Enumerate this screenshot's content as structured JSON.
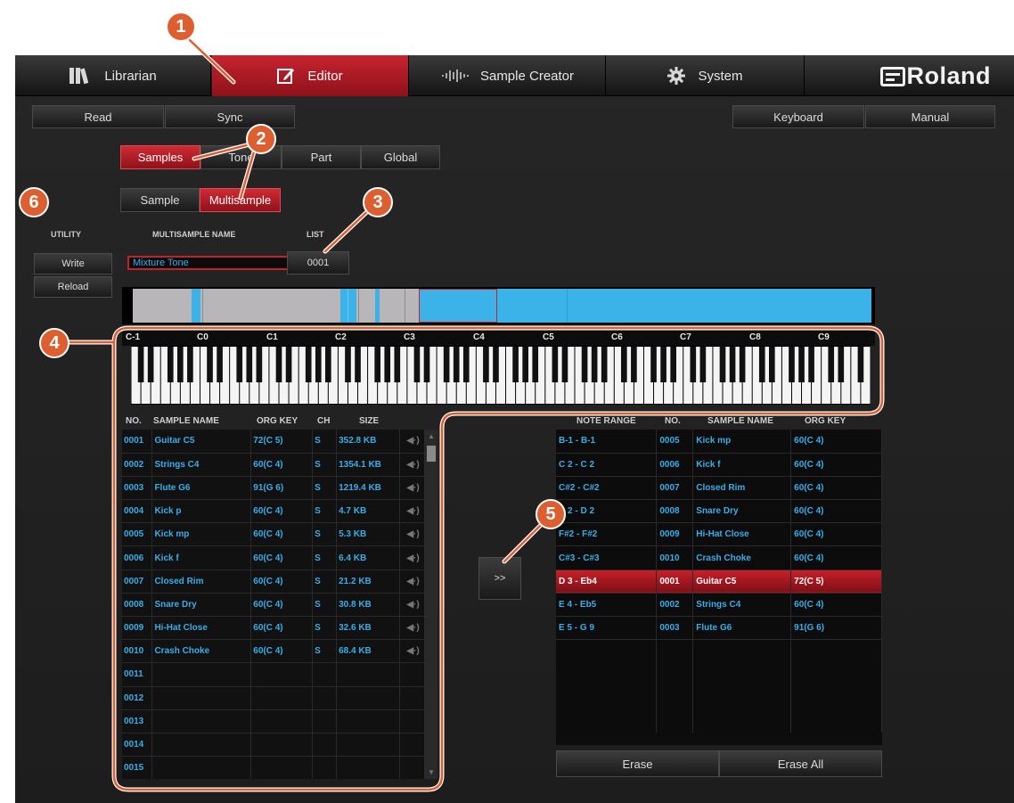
{
  "nav": {
    "tabs": [
      {
        "label": "Librarian",
        "icon": "library-icon"
      },
      {
        "label": "Editor",
        "icon": "edit-icon"
      },
      {
        "label": "Sample Creator",
        "icon": "waveform-icon"
      },
      {
        "label": "System",
        "icon": "gear-icon"
      }
    ],
    "logo": "Roland",
    "active_tab": "Editor"
  },
  "toolbar": {
    "read": "Read",
    "sync": "Sync",
    "keyboard": "Keyboard",
    "manual": "Manual"
  },
  "edit_tabs": {
    "samples": "Samples",
    "tone": "Tone",
    "part": "Part",
    "global": "Global",
    "active": "Samples"
  },
  "sub_tabs": {
    "sample": "Sample",
    "multisample": "Multisample",
    "active": "Multisample"
  },
  "utility": {
    "header": "UTILITY",
    "write": "Write",
    "reload": "Reload"
  },
  "multisample": {
    "name_header": "MULTISAMPLE NAME",
    "name": "Mixture Tone",
    "list_header": "LIST",
    "list_value": "0001"
  },
  "keyboard": {
    "octave_labels": [
      "C-1",
      "C0",
      "C1",
      "C2",
      "C3",
      "C4",
      "C5",
      "C6",
      "C7",
      "C8",
      "C9"
    ]
  },
  "sample_table": {
    "headers": [
      "NO.",
      "SAMPLE NAME",
      "ORG KEY",
      "CH",
      "SIZE"
    ],
    "rows": [
      [
        "0001",
        "Guitar C5",
        "72(C 5)",
        "S",
        "352.8 KB"
      ],
      [
        "0002",
        "Strings C4",
        "60(C 4)",
        "S",
        "1354.1 KB"
      ],
      [
        "0003",
        "Flute G6",
        "91(G 6)",
        "S",
        "1219.4 KB"
      ],
      [
        "0004",
        "Kick p",
        "60(C 4)",
        "S",
        "4.7 KB"
      ],
      [
        "0005",
        "Kick mp",
        "60(C 4)",
        "S",
        "5.3 KB"
      ],
      [
        "0006",
        "Kick f",
        "60(C 4)",
        "S",
        "6.4 KB"
      ],
      [
        "0007",
        "Closed Rim",
        "60(C 4)",
        "S",
        "21.2 KB"
      ],
      [
        "0008",
        "Snare Dry",
        "60(C 4)",
        "S",
        "30.8 KB"
      ],
      [
        "0009",
        "Hi-Hat Close",
        "60(C 4)",
        "S",
        "32.6 KB"
      ],
      [
        "0010",
        "Crash Choke",
        "60(C 4)",
        "S",
        "68.4 KB"
      ],
      [
        "0011",
        "",
        "",
        "",
        ""
      ],
      [
        "0012",
        "",
        "",
        "",
        ""
      ],
      [
        "0013",
        "",
        "",
        "",
        ""
      ],
      [
        "0014",
        "",
        "",
        "",
        ""
      ],
      [
        "0015",
        "",
        "",
        "",
        ""
      ]
    ]
  },
  "assign_button": ">>",
  "range_table": {
    "headers": [
      "NOTE RANGE",
      "NO.",
      "SAMPLE NAME",
      "ORG KEY"
    ],
    "rows": [
      [
        "B-1 - B-1",
        "0005",
        "Kick mp",
        "60(C 4)"
      ],
      [
        "C 2 - C 2",
        "0006",
        "Kick f",
        "60(C 4)"
      ],
      [
        "C#2 - C#2",
        "0007",
        "Closed Rim",
        "60(C 4)"
      ],
      [
        "D 2 - D 2",
        "0008",
        "Snare Dry",
        "60(C 4)"
      ],
      [
        "F#2 - F#2",
        "0009",
        "Hi-Hat Close",
        "60(C 4)"
      ],
      [
        "C#3 - C#3",
        "0010",
        "Crash Choke",
        "60(C 4)"
      ],
      [
        "D 3 - Eb4",
        "0001",
        "Guitar C5",
        "72(C 5)"
      ],
      [
        "E 4 - Eb5",
        "0002",
        "Strings C4",
        "60(C 4)"
      ],
      [
        "E 5 - G 9",
        "0003",
        "Flute G6",
        "91(G 6)"
      ]
    ],
    "selected_index": 6
  },
  "erase": {
    "erase": "Erase",
    "erase_all": "Erase All"
  },
  "callouts": [
    "1",
    "2",
    "3",
    "4",
    "5",
    "6"
  ],
  "colors": {
    "accent_red": "#c8202a",
    "zone_blue": "#3cb3e8",
    "text_blue": "#39aee9",
    "callout_orange": "#dd5e2f"
  }
}
